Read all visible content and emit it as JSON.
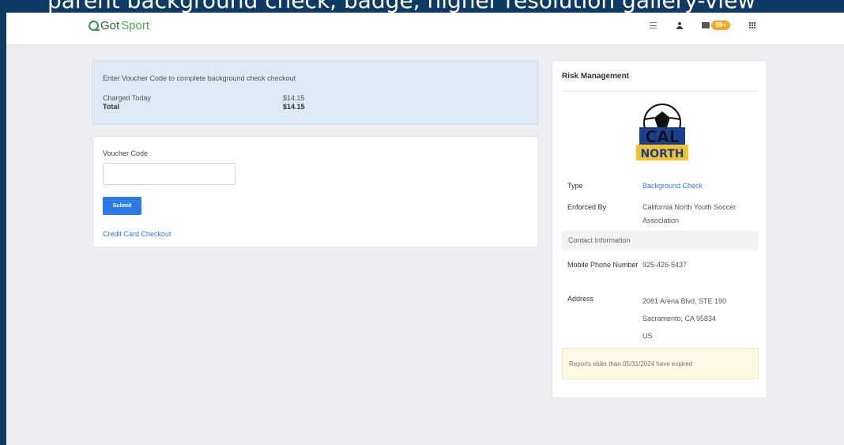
{
  "caption": "parent background check, badge, higher resolution gallery-view",
  "header": {
    "logo_got": "Got",
    "logo_sport": "Sport",
    "notification_count": "99+"
  },
  "voucher_banner": {
    "message": "Enter Voucher Code to complete background check checkout",
    "charged_today_label": "Charged Today",
    "charged_today_value": "$14.15",
    "total_label": "Total",
    "total_value": "$14.15"
  },
  "form": {
    "voucher_label": "Voucher Code",
    "voucher_value": "",
    "submit_label": "Submit",
    "credit_card_link": "Credit Card Checkout"
  },
  "risk_management": {
    "title": "Risk Management",
    "logo_text_top": "CAL",
    "logo_text_bottom": "NORTH",
    "type_label": "Type",
    "type_value": "Background Check",
    "enforced_label": "Enforced By",
    "enforced_value": "California North Youth Soccer Association",
    "contact_header": "Contact Information",
    "phone_label": "Mobile Phone Number",
    "phone_value": "925-426-5437",
    "address_label": "Address",
    "address_line1": "2081 Arena Blvd, STE 190",
    "address_line2": "Sacramento, CA 95834",
    "address_line3": "US",
    "expiry_notice": "Reports older than 05/31/2024 have expired"
  },
  "colors": {
    "accent_blue": "#2c7be5",
    "brand_green": "#2f9e44",
    "badge_orange": "#f5a623",
    "frame_navy": "#0d3b66"
  }
}
